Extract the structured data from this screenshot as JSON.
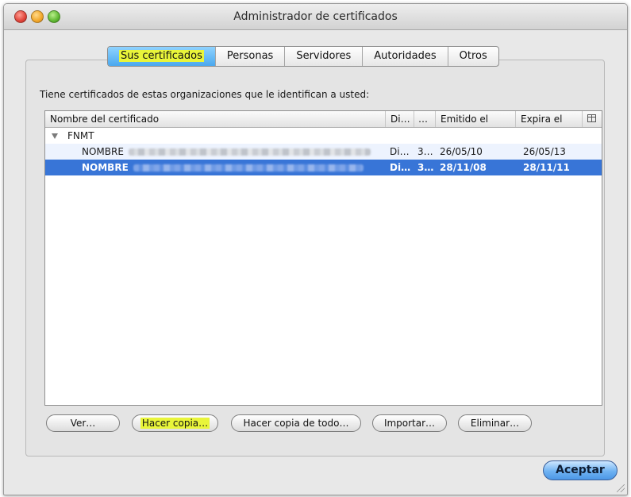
{
  "window": {
    "title": "Administrador de certificados"
  },
  "tabs": [
    {
      "label": "Sus certificados",
      "active": true
    },
    {
      "label": "Personas",
      "active": false
    },
    {
      "label": "Servidores",
      "active": false
    },
    {
      "label": "Autoridades",
      "active": false
    },
    {
      "label": "Otros",
      "active": false
    }
  ],
  "intro_text": "Tiene certificados de estas organizaciones que le identifican a usted:",
  "table": {
    "columns": [
      "Nombre del certificado",
      "Di…",
      "…",
      "Emitido el",
      "Expira el"
    ],
    "column_picker_icon": "column-picker-icon",
    "group": {
      "label": "FNMT",
      "expanded": true
    },
    "rows": [
      {
        "name": "NOMBRE",
        "col2": "Di…",
        "col3": "3…",
        "issued": "26/05/10",
        "expires": "26/05/13",
        "selected": false
      },
      {
        "name": "NOMBRE",
        "col2": "Di…",
        "col3": "3…",
        "issued": "28/11/08",
        "expires": "28/11/11",
        "selected": true
      }
    ]
  },
  "buttons": {
    "view": "Ver…",
    "backup": "Hacer copia…",
    "backup_all": "Hacer copia de todo…",
    "import": "Importar…",
    "delete": "Eliminar…",
    "accept": "Aceptar"
  },
  "colors": {
    "selection": "#3875d7",
    "highlight": "#e9f53a",
    "active_tab": "#4aa8ee"
  }
}
